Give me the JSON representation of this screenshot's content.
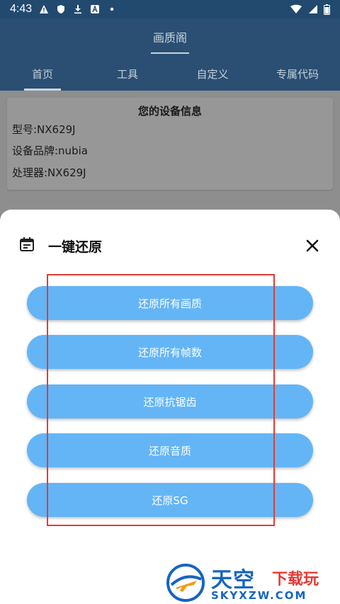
{
  "status_bar": {
    "time": "4:43",
    "left_icons": [
      "alert-icon",
      "shield-icon",
      "download-icon",
      "a-icon",
      "dot-icon"
    ],
    "right_icons": [
      "wifi-icon",
      "signal-icon",
      "battery-icon"
    ]
  },
  "app": {
    "title": "画质阁",
    "tabs": [
      {
        "label": "首页",
        "active": true
      },
      {
        "label": "工具",
        "active": false
      },
      {
        "label": "自定义",
        "active": false
      },
      {
        "label": "专属代码",
        "active": false
      }
    ]
  },
  "device_card": {
    "title": "您的设备信息",
    "lines": [
      "型号:NX629J",
      "设备品牌:nubia",
      "处理器:NX629J"
    ]
  },
  "sheet": {
    "icon": "calendar-icon",
    "title": "一键还原",
    "buttons": [
      "还原所有画质",
      "还原所有帧数",
      "还原抗锯齿",
      "还原音质",
      "还原SG"
    ]
  },
  "colors": {
    "button_bg": "#64b5f6",
    "appbar": "#2a4f73",
    "highlight_box": "#e53935"
  },
  "watermark": {
    "main": "天空",
    "sub": "下载玩",
    "url": "SKYXZW.COM"
  }
}
